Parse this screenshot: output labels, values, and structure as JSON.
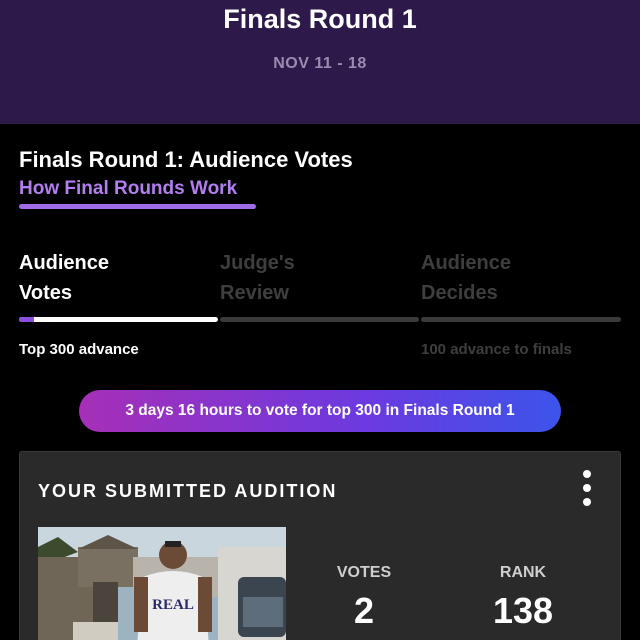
{
  "header": {
    "title": "Finals Round 1",
    "dates": "NOV 11 - 18"
  },
  "section": {
    "title": "Finals Round 1: Audience Votes",
    "how_link": "How Final Rounds Work"
  },
  "steps": [
    {
      "line1": "Audience",
      "line2": "Votes",
      "state": "active"
    },
    {
      "line1": "Judge's",
      "line2": "Review",
      "state": "inactive"
    },
    {
      "line1": "Audience",
      "line2": "Decides",
      "state": "inactive"
    }
  ],
  "advance": {
    "left": "Top 300 advance",
    "right": "100 advance to finals"
  },
  "timer": "3 days 16 hours to vote for top 300 in Finals Round 1",
  "card": {
    "title": "YOUR SUBMITTED AUDITION",
    "menu_icon": "kebab-menu-icon",
    "thumbnail_shirt_text": "REAL",
    "votes_label": "VOTES",
    "votes_value": "2",
    "rank_label": "RANK",
    "rank_value": "138"
  },
  "colors": {
    "header_bg": "#2e1a4a",
    "accent": "#a06be6",
    "pill_start": "#a62fb7",
    "pill_end": "#3c54ea",
    "card_bg": "#2a2a2a"
  }
}
